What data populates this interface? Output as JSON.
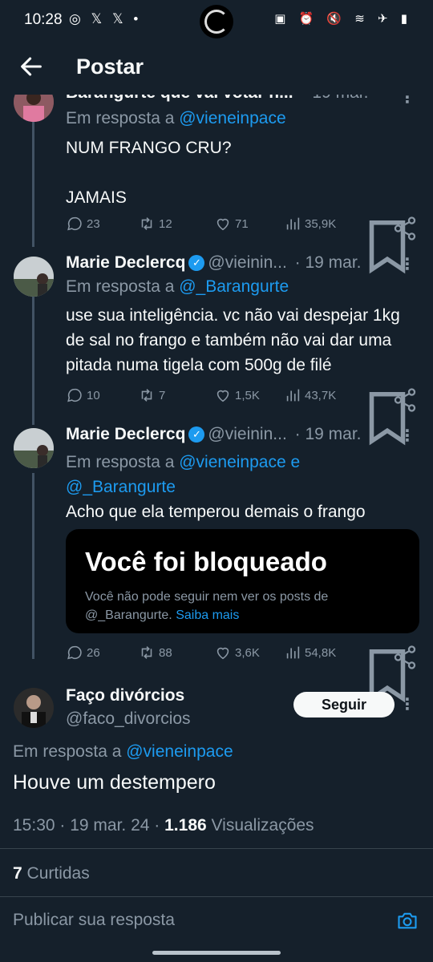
{
  "status": {
    "time": "10:28",
    "left_icons": "◎ 𝕏 𝕏 •",
    "right_icons": "▣ ⏰ 🔇 ≋ ✈ ▮"
  },
  "header": {
    "title": "Postar"
  },
  "top_tweet": {
    "author": "Barangurte que vai votar n...",
    "date": "19 mar.",
    "reply_prefix": "Em resposta a ",
    "reply_to": "@vieneinpace",
    "text_line1": "NUM FRANGO CRU?",
    "text_line2": "JAMAIS",
    "replies": "23",
    "retweets": "12",
    "likes": "71",
    "views": "35,9K"
  },
  "tweet2": {
    "author": "Marie Declercq",
    "handle": "@viei​nin...",
    "date": "· 19 mar.",
    "reply_prefix": "Em resposta a ",
    "reply_to": "@_Barangurte",
    "text": "use sua inteligência. vc não vai despejar 1kg de sal no frango e também não vai dar uma pitada numa tigela com 500g de filé",
    "replies": "10",
    "retweets": "7",
    "likes": "1,5K",
    "views": "43,7K"
  },
  "tweet3": {
    "author": "Marie Declercq",
    "handle": "@viei​nin...",
    "date": "· 19 mar.",
    "reply_prefix": "Em resposta a ",
    "reply_to_1": "@vieneinpace e",
    "reply_to_2": "@_Barangurte",
    "text": "Acho que ela temperou demais o frango",
    "card_title": "Você foi bloqueado",
    "card_text": "Você não pode seguir nem ver os posts de @_Barangurte.",
    "card_link": "Saiba mais",
    "replies": "26",
    "retweets": "88",
    "likes": "3,6K",
    "views": "54,8K"
  },
  "main_tweet": {
    "author": "Faço divórcios",
    "handle": "@faco_divorcios",
    "follow_label": "Seguir",
    "reply_prefix": "Em resposta a ",
    "reply_to": "@vieneinpace",
    "text": "Houve um destempero",
    "time": "15:30 · 19 mar. 24 ·",
    "views_count": "1.186",
    "views_label": "Visualizações",
    "likes_count": "7",
    "likes_label": "Curtidas"
  },
  "reply_bar": {
    "placeholder": "Publicar sua resposta"
  },
  "colors": {
    "background": "#15202b",
    "accent": "#1d9bf0",
    "muted": "#8b98a5"
  }
}
